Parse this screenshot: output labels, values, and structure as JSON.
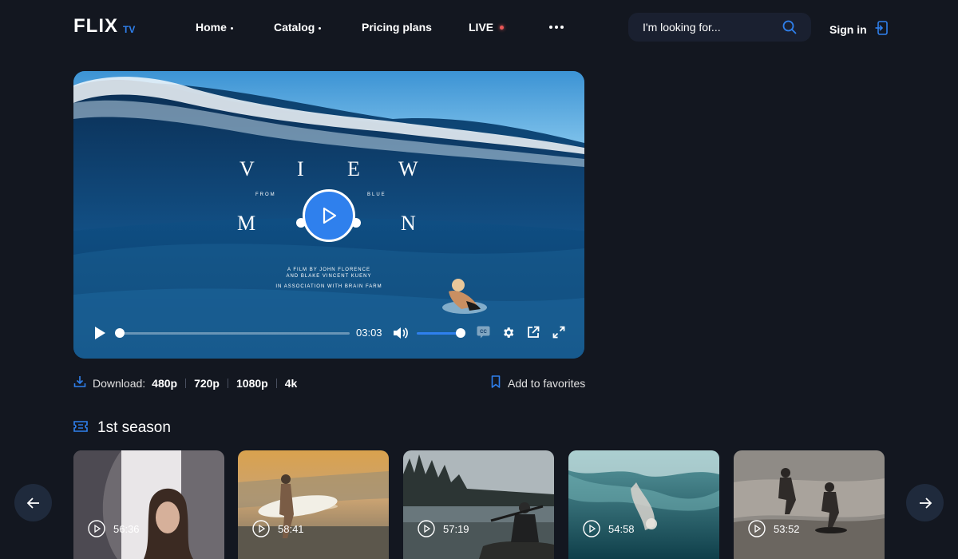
{
  "header": {
    "logo_main": "FLIX",
    "logo_sub": "TV",
    "nav": {
      "home": "Home",
      "catalog": "Catalog",
      "pricing": "Pricing plans",
      "live": "LIVE"
    },
    "search_placeholder": "I'm looking for...",
    "signin": "Sign in"
  },
  "player": {
    "title_line1": [
      "V",
      "I",
      "E",
      "W"
    ],
    "title_line2": [
      "M",
      "N"
    ],
    "from": "FROM",
    "blue": "BLUE",
    "credit_1": "A FILM BY JOHN FLORENCE",
    "credit_2": "AND BLAKE VINCENT KUENY",
    "credit_3": "IN ASSOCIATION WITH BRAIN FARM",
    "time": "03:03",
    "progress": 0.0,
    "volume": 1.0,
    "cc_label": "CC"
  },
  "download": {
    "label": "Download:",
    "qualities": [
      "480p",
      "720p",
      "1080p",
      "4k"
    ]
  },
  "favorites": "Add to favorites",
  "season": {
    "title": "1st season",
    "episodes": [
      {
        "duration": "56:36"
      },
      {
        "duration": "58:41"
      },
      {
        "duration": "57:19"
      },
      {
        "duration": "54:58"
      },
      {
        "duration": "53:52"
      }
    ]
  },
  "colors": {
    "background": "#131720",
    "accent": "#2f80ed",
    "live": "#eb5757",
    "surface": "#1a2030"
  }
}
